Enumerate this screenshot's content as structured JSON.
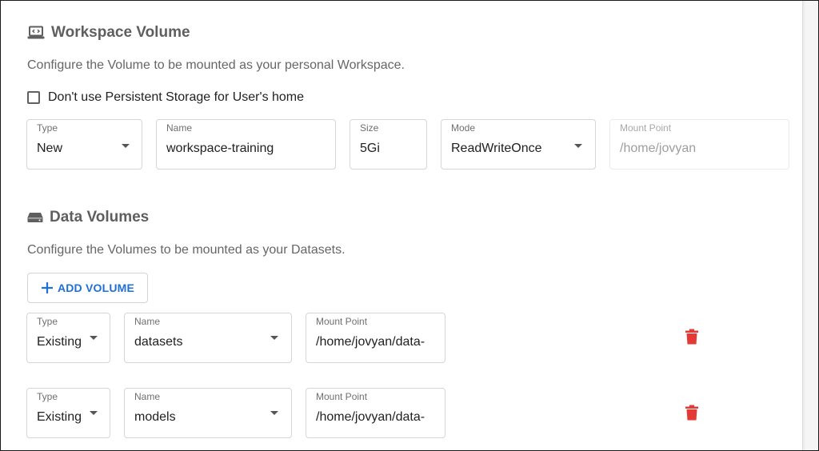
{
  "workspace": {
    "title": "Workspace Volume",
    "icon": "laptop-code-icon",
    "description": "Configure the Volume to be mounted as your personal Workspace.",
    "checkbox_label": "Don't use Persistent Storage for User's home",
    "checkbox_checked": false,
    "fields": {
      "type": {
        "label": "Type",
        "value": "New"
      },
      "name": {
        "label": "Name",
        "value": "workspace-training"
      },
      "size": {
        "label": "Size",
        "value": "5Gi"
      },
      "mode": {
        "label": "Mode",
        "value": "ReadWriteOnce"
      },
      "mount": {
        "label": "Mount Point",
        "value": "/home/jovyan"
      }
    }
  },
  "data_volumes": {
    "title": "Data Volumes",
    "icon": "hard-drive-icon",
    "description": "Configure the Volumes to be mounted as your Datasets.",
    "add_button": "ADD VOLUME",
    "rows": [
      {
        "type": {
          "label": "Type",
          "value": "Existing"
        },
        "name": {
          "label": "Name",
          "value": "datasets"
        },
        "mount": {
          "label": "Mount Point",
          "value": "/home/jovyan/data-"
        }
      },
      {
        "type": {
          "label": "Type",
          "value": "Existing"
        },
        "name": {
          "label": "Name",
          "value": "models"
        },
        "mount": {
          "label": "Mount Point",
          "value": "/home/jovyan/data-"
        }
      }
    ]
  },
  "colors": {
    "accent": "#1e6fd9",
    "delete": "#e53935",
    "title": "#5f5f5f"
  }
}
